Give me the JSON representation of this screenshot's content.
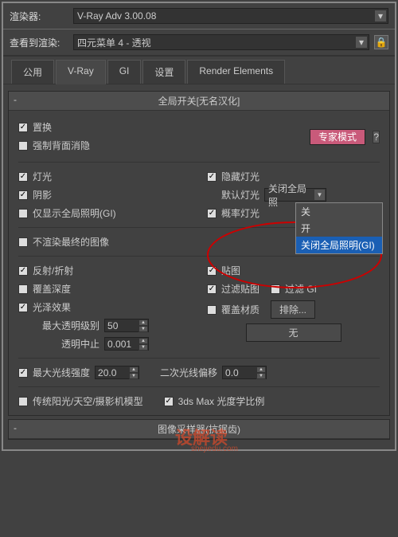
{
  "top": {
    "renderer_label": "渲染器:",
    "renderer_value": "V-Ray Adv 3.00.08",
    "view_label": "查看到渲染:",
    "view_value": "四元菜单 4 - 透视"
  },
  "tabs": [
    "公用",
    "V-Ray",
    "GI",
    "设置",
    "Render Elements"
  ],
  "rollout_title": "全局开关[无名汉化]",
  "group1": {
    "displacement": "置换",
    "force_backface": "强制背面消隐",
    "expert_mode": "专家模式",
    "help": "?"
  },
  "group2": {
    "lights": "灯光",
    "shadows": "阴影",
    "show_gi_only": "仅显示全局照明(GI)",
    "hidden_lights": "隐藏灯光",
    "default_lights": "默认灯光",
    "prob_lights": "概率灯光",
    "default_lights_value": "关闭全局照"
  },
  "dropdown_open": {
    "opt1": "关",
    "opt2": "开",
    "opt3": "关闭全局照明(GI)"
  },
  "group3": {
    "no_render_final": "不渲染最终的图像"
  },
  "group4": {
    "reflect_refract": "反射/折射",
    "override_depth": "覆盖深度",
    "glossy": "光泽效果",
    "max_transp_label": "最大透明级别",
    "max_transp_val": "50",
    "transp_cutoff_label": "透明中止",
    "transp_cutoff_val": "0.001",
    "maps": "贴图",
    "filter_maps": "过滤贴图",
    "filter_gi": "过滤 GI",
    "override_mtl": "覆盖材质",
    "exclude": "排除...",
    "none": "无"
  },
  "group5": {
    "max_ray_intens": "最大光线强度",
    "max_ray_val": "20.0",
    "sec_ray_bias": "二次光线偏移",
    "sec_ray_val": "0.0"
  },
  "group6": {
    "legacy": "传统阳光/天空/摄影机模型",
    "max_photometric": "3ds Max 光度学比例"
  },
  "rollout2_title": "图像采样器(抗锯齿)"
}
